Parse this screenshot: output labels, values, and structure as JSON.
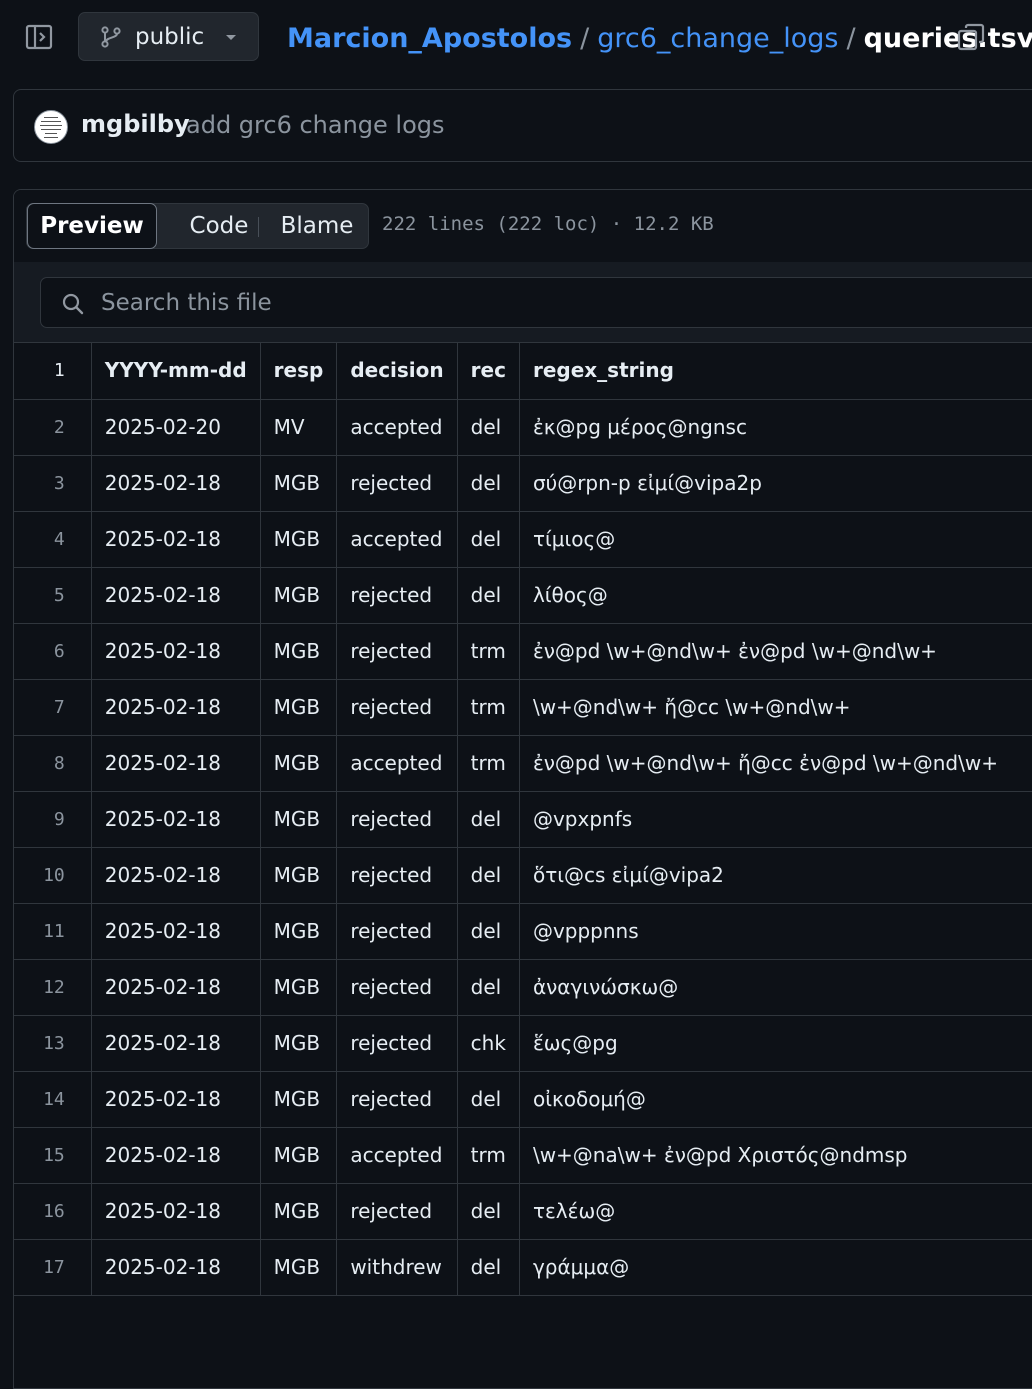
{
  "header": {
    "branch_label": "public",
    "breadcrumb": {
      "owner": "Marcion_Apostolos",
      "separator": "/",
      "folder": "grc6_change_logs",
      "file": "queries.tsv"
    }
  },
  "commit": {
    "author": "mgbilby",
    "message": "add grc6 change logs"
  },
  "file_view": {
    "tabs": {
      "preview": "Preview",
      "code": "Code",
      "blame": "Blame"
    },
    "meta": "222 lines (222 loc) · 12.2 KB",
    "search_placeholder": "Search this file"
  },
  "table": {
    "header": {
      "line": "1",
      "cols": [
        "YYYY-mm-dd",
        "resp",
        "decision",
        "rec",
        "regex_string"
      ]
    },
    "rows": [
      {
        "line": "2",
        "cells": [
          "2025-02-20",
          "MV",
          "accepted",
          "del",
          "ἐκ@pg μέρος@ngnsc"
        ]
      },
      {
        "line": "3",
        "cells": [
          "2025-02-18",
          "MGB",
          "rejected",
          "del",
          "σύ@rpn-p εἰμί@vipa2p"
        ]
      },
      {
        "line": "4",
        "cells": [
          "2025-02-18",
          "MGB",
          "accepted",
          "del",
          "τίμιος@"
        ]
      },
      {
        "line": "5",
        "cells": [
          "2025-02-18",
          "MGB",
          "rejected",
          "del",
          "λίθος@"
        ]
      },
      {
        "line": "6",
        "cells": [
          "2025-02-18",
          "MGB",
          "rejected",
          "trm",
          "ἐν@pd \\w+@nd\\w+ ἐν@pd \\w+@nd\\w+"
        ]
      },
      {
        "line": "7",
        "cells": [
          "2025-02-18",
          "MGB",
          "rejected",
          "trm",
          "\\w+@nd\\w+ ἤ@cc \\w+@nd\\w+"
        ]
      },
      {
        "line": "8",
        "cells": [
          "2025-02-18",
          "MGB",
          "accepted",
          "trm",
          "ἐν@pd \\w+@nd\\w+ ἤ@cc ἐν@pd \\w+@nd\\w+"
        ]
      },
      {
        "line": "9",
        "cells": [
          "2025-02-18",
          "MGB",
          "rejected",
          "del",
          "@vpxpnfs"
        ]
      },
      {
        "line": "10",
        "cells": [
          "2025-02-18",
          "MGB",
          "rejected",
          "del",
          "ὅτι@cs εἰμί@vipa2"
        ]
      },
      {
        "line": "11",
        "cells": [
          "2025-02-18",
          "MGB",
          "rejected",
          "del",
          "@vpppnns"
        ]
      },
      {
        "line": "12",
        "cells": [
          "2025-02-18",
          "MGB",
          "rejected",
          "del",
          "ἀναγινώσκω@"
        ]
      },
      {
        "line": "13",
        "cells": [
          "2025-02-18",
          "MGB",
          "rejected",
          "chk",
          "ἕως@pg"
        ]
      },
      {
        "line": "14",
        "cells": [
          "2025-02-18",
          "MGB",
          "rejected",
          "del",
          "οἰκοδομή@"
        ]
      },
      {
        "line": "15",
        "cells": [
          "2025-02-18",
          "MGB",
          "accepted",
          "trm",
          "\\w+@na\\w+ ἐν@pd Χριστός@ndmsp"
        ]
      },
      {
        "line": "16",
        "cells": [
          "2025-02-18",
          "MGB",
          "rejected",
          "del",
          "τελέω@"
        ]
      },
      {
        "line": "17",
        "cells": [
          "2025-02-18",
          "MGB",
          "withdrew",
          "del",
          "γράμμα@"
        ]
      }
    ]
  }
}
